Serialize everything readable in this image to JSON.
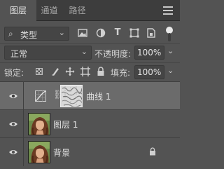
{
  "tabs": [
    {
      "label": "图层",
      "active": true
    },
    {
      "label": "通道",
      "active": false
    },
    {
      "label": "路径",
      "active": false
    }
  ],
  "filter": {
    "kind_label": "类型",
    "icons": [
      "image-filter-icon",
      "adjustment-filter-icon",
      "type-filter-icon",
      "shape-filter-icon",
      "smart-object-filter-icon"
    ]
  },
  "blend": {
    "mode": "正常",
    "opacity_label": "不透明度:",
    "opacity_value": "100%"
  },
  "lock": {
    "label": "锁定:",
    "fill_label": "填充:",
    "fill_value": "100%"
  },
  "layers": [
    {
      "name": "曲线 1",
      "type": "adjustment",
      "selected": true,
      "visible": true
    },
    {
      "name": "图层 1",
      "type": "pixel",
      "selected": false,
      "visible": true
    },
    {
      "name": "背景",
      "type": "background",
      "selected": false,
      "visible": true,
      "locked": true
    }
  ],
  "colors": {
    "panel_bg": "#535353",
    "tabbar_bg": "#3d3d3d",
    "selected_layer_bg": "#6b6b6b",
    "field_bg": "#454545"
  }
}
